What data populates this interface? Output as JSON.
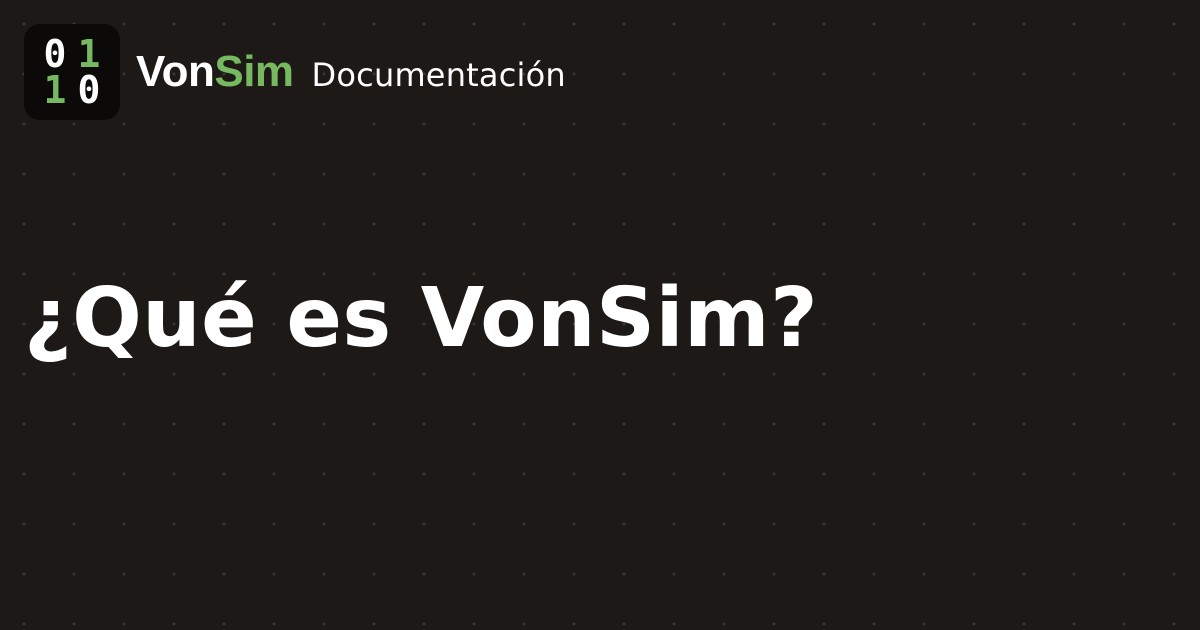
{
  "logo": {
    "digits": [
      "0",
      "1",
      "1",
      "0"
    ]
  },
  "brand": {
    "name_part1": "Von",
    "name_part2": "Sim",
    "subtitle": "Documentación"
  },
  "page": {
    "title": "¿Qué es VonSim?"
  },
  "colors": {
    "background": "#1c1917",
    "accent": "#77b961",
    "text": "#ffffff",
    "logo_background": "#0b0a09"
  }
}
